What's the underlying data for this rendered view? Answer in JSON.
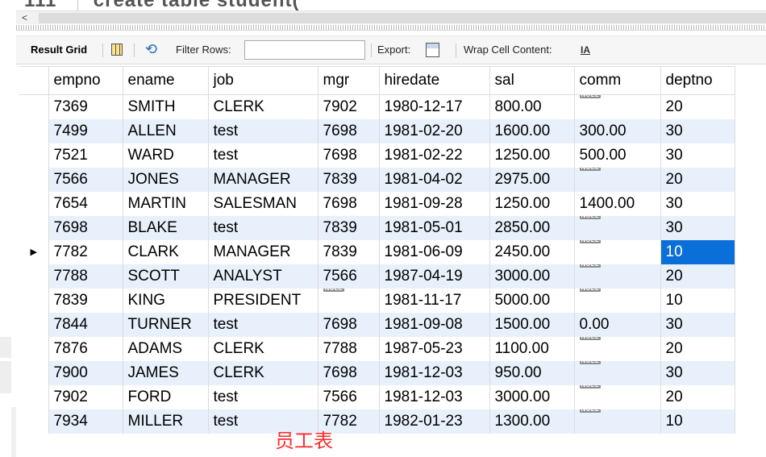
{
  "editor": {
    "line_number": "111",
    "partial_text": "create  table  student("
  },
  "scroll": {
    "left_arrow": "<"
  },
  "toolbar": {
    "result_grid_label": "Result Grid",
    "filter_label": "Filter Rows:",
    "filter_value": "",
    "export_label": "Export:",
    "wrap_label": "Wrap Cell Content:",
    "wrap_icon": "IA",
    "refresh_icon": "refresh-icon"
  },
  "grid": {
    "columns": [
      "empno",
      "ename",
      "job",
      "mgr",
      "hiredate",
      "sal",
      "comm",
      "deptno"
    ],
    "null_label": "NULL",
    "current_row_marker": "▶",
    "selected": {
      "row": 6,
      "col": 7
    },
    "rows": [
      [
        "7369",
        "SMITH",
        "CLERK",
        "7902",
        "1980-12-17",
        "800.00",
        null,
        "20"
      ],
      [
        "7499",
        "ALLEN",
        "test",
        "7698",
        "1981-02-20",
        "1600.00",
        "300.00",
        "30"
      ],
      [
        "7521",
        "WARD",
        "test",
        "7698",
        "1981-02-22",
        "1250.00",
        "500.00",
        "30"
      ],
      [
        "7566",
        "JONES",
        "MANAGER",
        "7839",
        "1981-04-02",
        "2975.00",
        null,
        "20"
      ],
      [
        "7654",
        "MARTIN",
        "SALESMAN",
        "7698",
        "1981-09-28",
        "1250.00",
        "1400.00",
        "30"
      ],
      [
        "7698",
        "BLAKE",
        "test",
        "7839",
        "1981-05-01",
        "2850.00",
        null,
        "30"
      ],
      [
        "7782",
        "CLARK",
        "MANAGER",
        "7839",
        "1981-06-09",
        "2450.00",
        null,
        "10"
      ],
      [
        "7788",
        "SCOTT",
        "ANALYST",
        "7566",
        "1987-04-19",
        "3000.00",
        null,
        "20"
      ],
      [
        "7839",
        "KING",
        "PRESIDENT",
        null,
        "1981-11-17",
        "5000.00",
        null,
        "10"
      ],
      [
        "7844",
        "TURNER",
        "test",
        "7698",
        "1981-09-08",
        "1500.00",
        "0.00",
        "30"
      ],
      [
        "7876",
        "ADAMS",
        "CLERK",
        "7788",
        "1987-05-23",
        "1100.00",
        null,
        "20"
      ],
      [
        "7900",
        "JAMES",
        "CLERK",
        "7698",
        "1981-12-03",
        "950.00",
        null,
        "30"
      ],
      [
        "7902",
        "FORD",
        "test",
        "7566",
        "1981-12-03",
        "3000.00",
        null,
        "20"
      ],
      [
        "7934",
        "MILLER",
        "test",
        "7782",
        "1982-01-23",
        "1300.00",
        null,
        "10"
      ]
    ]
  },
  "caption": "员工表",
  "colors": {
    "selected": "#0a6fd8",
    "alt_row": "#e8f0fb",
    "caption": "#ff2a2a"
  }
}
